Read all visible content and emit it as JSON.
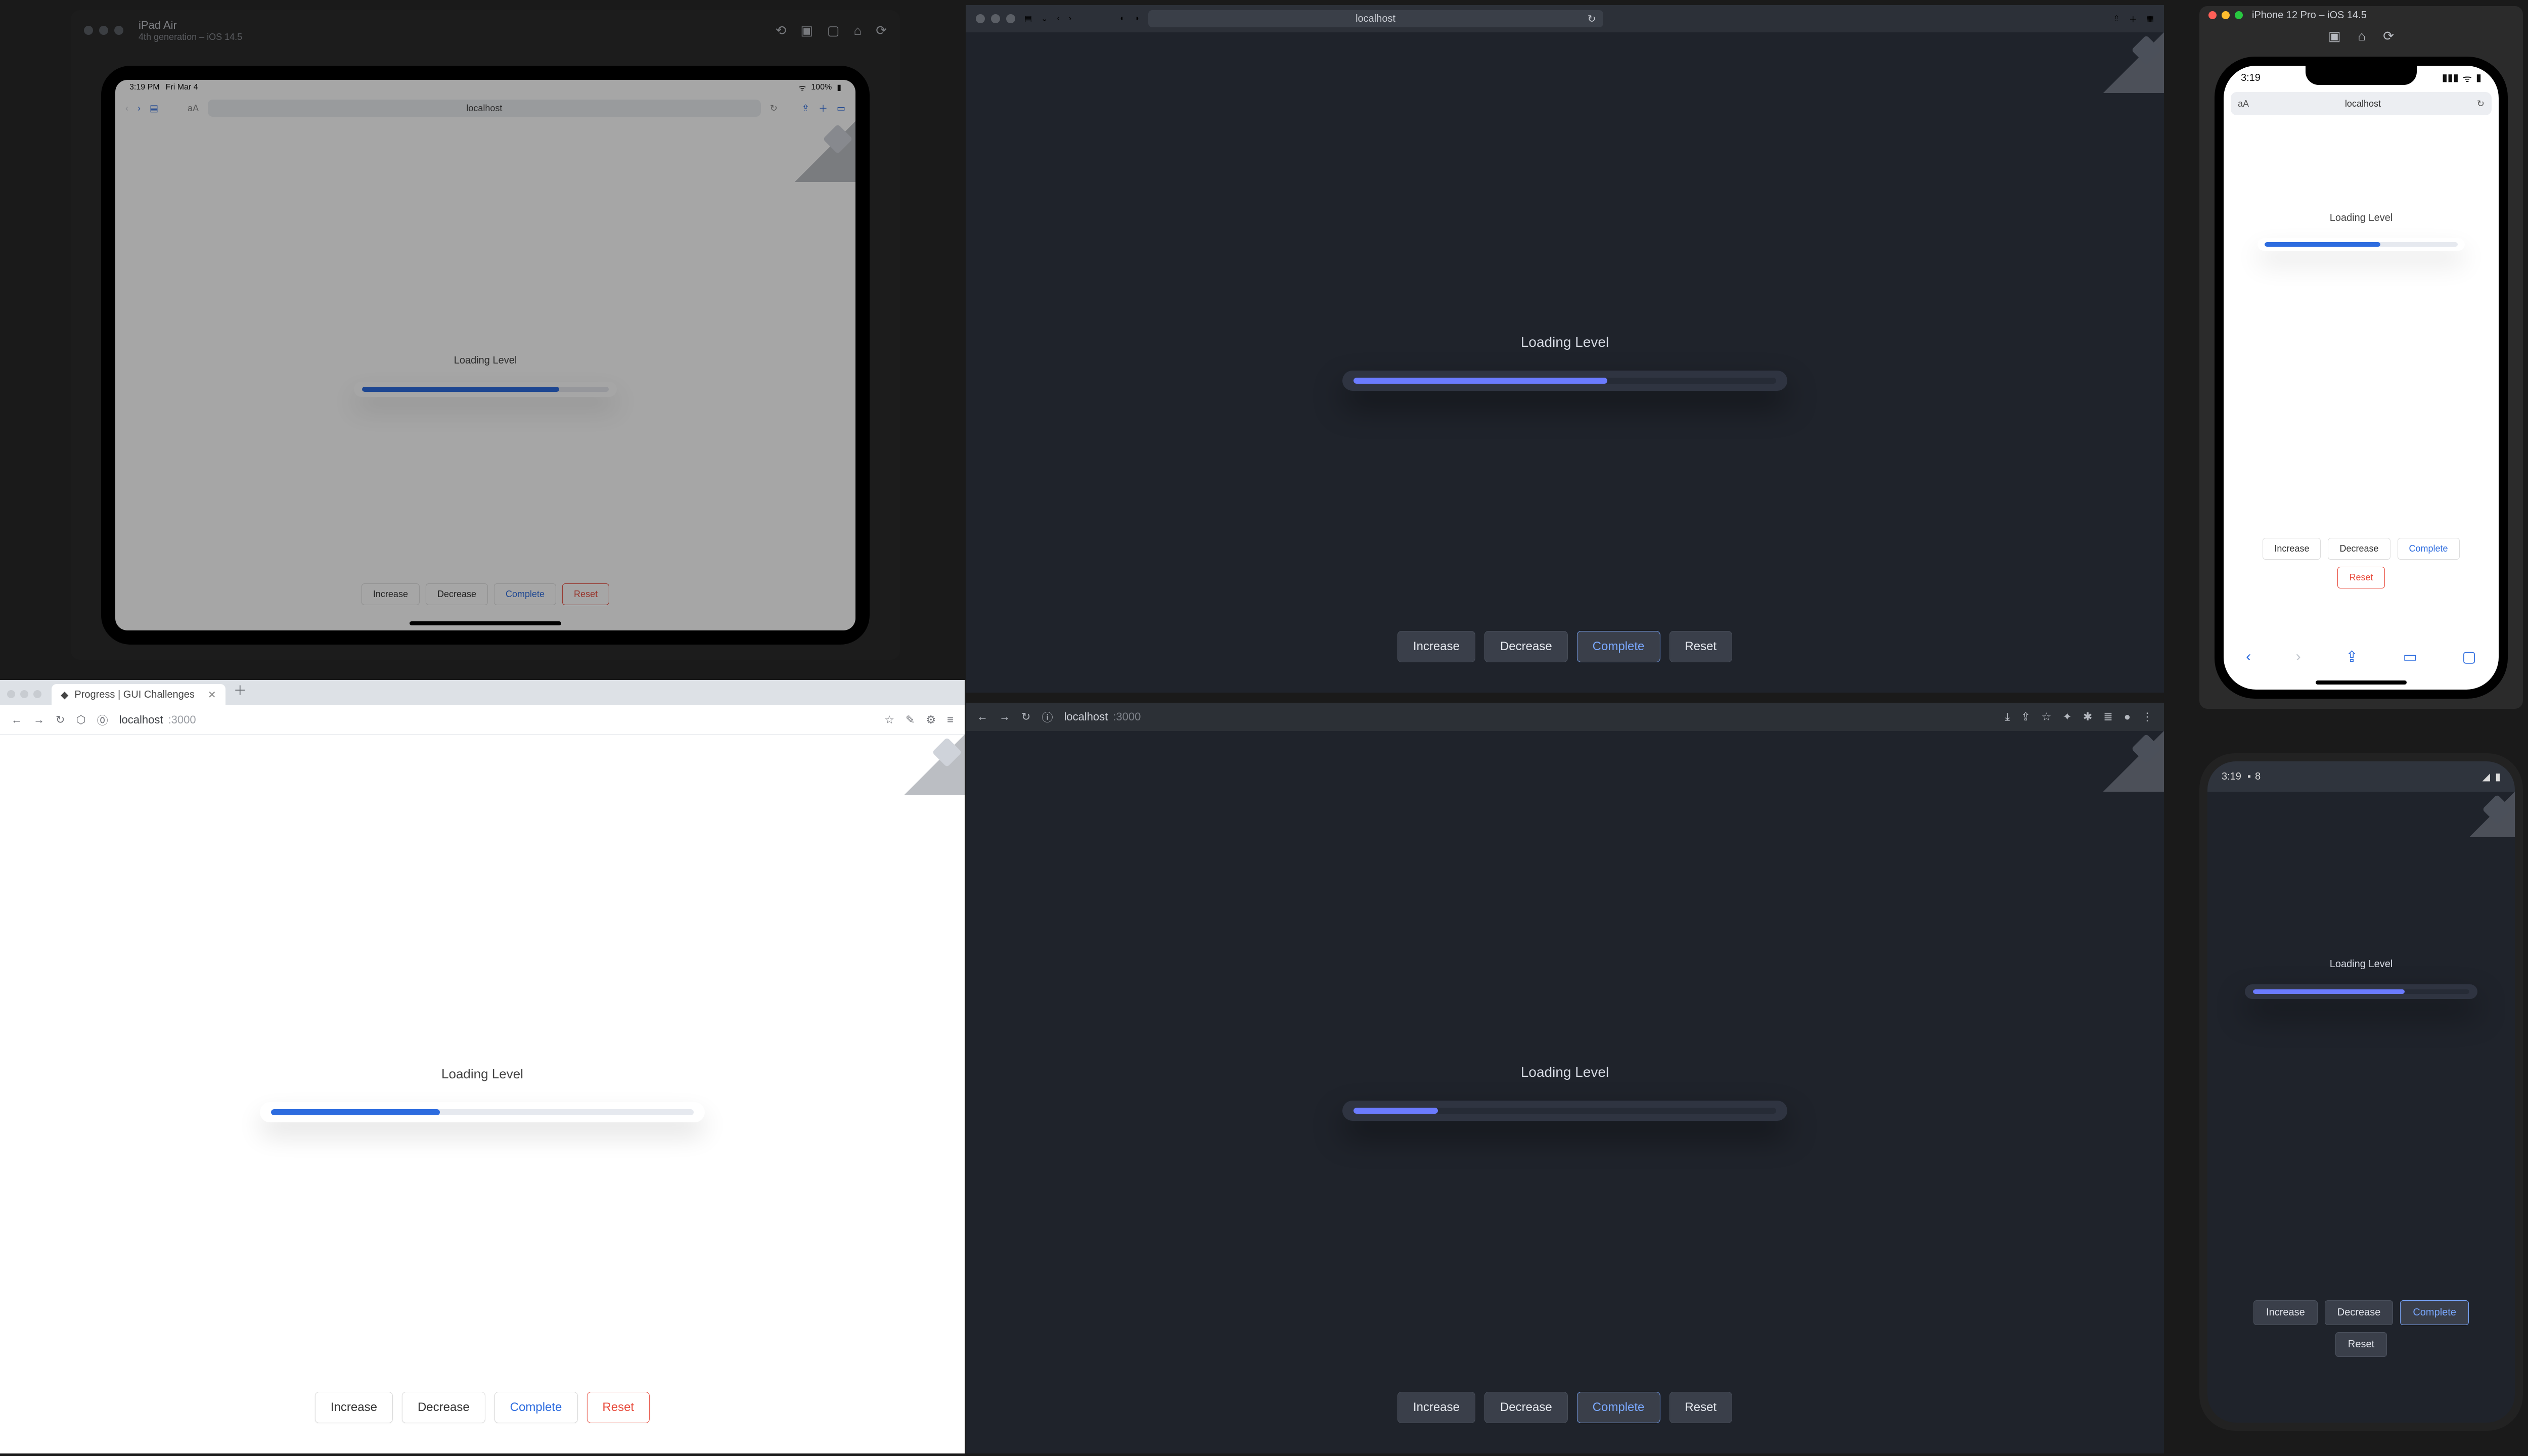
{
  "heading": "Loading Level",
  "progress": {
    "safari_dark": 60,
    "chrome_light": 40,
    "chrome_dark": 20,
    "ipad": 80,
    "iphone": 60,
    "android": 70
  },
  "buttons": {
    "increase": "Increase",
    "decrease": "Decrease",
    "complete": "Complete",
    "reset": "Reset"
  },
  "safari_dark": {
    "url": "localhost"
  },
  "chrome_light": {
    "tab_title": "Progress | GUI Challenges",
    "host": "localhost",
    "port": ":3000"
  },
  "chrome_dark": {
    "host": "localhost",
    "port": ":3000"
  },
  "sim_ipad": {
    "title": "iPad Air",
    "subtitle": "4th generation – iOS 14.5",
    "status_time": "3:19 PM",
    "status_date": "Fri Mar 4",
    "battery": "100%",
    "addr": "localhost"
  },
  "sim_iphone": {
    "title": "iPhone 12 Pro – iOS 14.5",
    "status_time": "3:19",
    "addr": "localhost",
    "aA": "aA"
  },
  "emu_android": {
    "status_time": "3:19",
    "status_temp": "8"
  }
}
